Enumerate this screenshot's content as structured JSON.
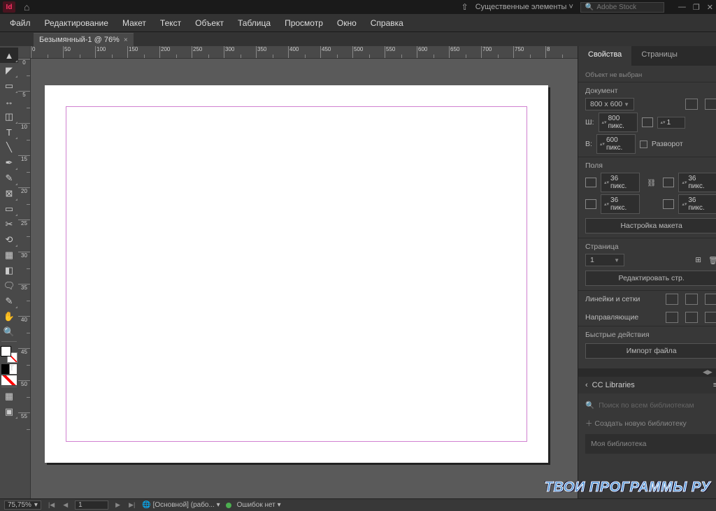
{
  "titlebar": {
    "app_logo": "Id",
    "workspace": "Существенные элементы",
    "stock_placeholder": "Adobe Stock"
  },
  "menu": {
    "file": "Файл",
    "edit": "Редактирование",
    "layout": "Макет",
    "type": "Текст",
    "object": "Объект",
    "table": "Таблица",
    "view": "Просмотр",
    "window": "Окно",
    "help": "Справка"
  },
  "tab": {
    "title": "Безымянный-1 @ 76%",
    "close": "×"
  },
  "ruler_h": [
    "0",
    "50",
    "100",
    "150",
    "200",
    "250",
    "300",
    "350",
    "400",
    "450",
    "500",
    "550",
    "600",
    "650",
    "700",
    "750",
    "8"
  ],
  "ruler_v": [
    "0",
    "5",
    "10",
    "15",
    "20",
    "25",
    "30",
    "35",
    "40",
    "45",
    "50",
    "55"
  ],
  "props": {
    "tab_properties": "Свойства",
    "tab_pages": "Страницы",
    "no_selection": "Объект не выбран",
    "doc_label": "Документ",
    "doc_preset": "800 x 600",
    "w_label": "Ш:",
    "h_label": "В:",
    "w_val": "800 пикс.",
    "h_val": "600 пикс.",
    "pages_count": "1",
    "spread_label": "Разворот",
    "margins_label": "Поля",
    "m_val": "36 пикс.",
    "layout_btn": "Настройка макета",
    "page_section": "Страница",
    "page_num": "1",
    "edit_page_btn": "Редактировать стр.",
    "rulers_label": "Линейки и сетки",
    "guides_label": "Направляющие",
    "quick_label": "Быстрые действия",
    "import_btn": "Импорт файла"
  },
  "cc": {
    "title": "CC Libraries",
    "search_ph": "Поиск по всем библиотекам",
    "new_lib": "Создать новую библиотеку",
    "my_lib": "Моя библиотека"
  },
  "status": {
    "zoom": "75,75%",
    "page": "1",
    "master": "[Основной] (рабо...",
    "errors": "Ошибок нет"
  },
  "watermark": "ТВОИ ПРОГРАММЫ РУ"
}
